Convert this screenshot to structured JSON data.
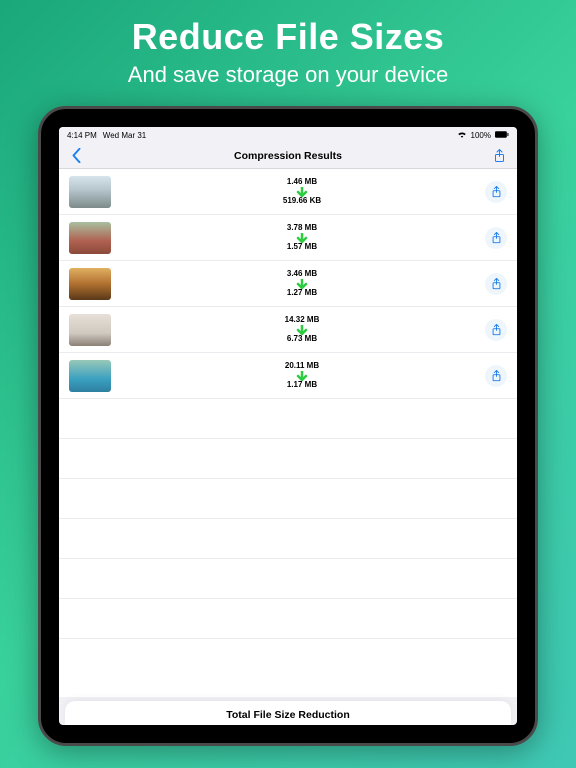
{
  "hero": {
    "title": "Reduce File Sizes",
    "subtitle": "And save storage on your device"
  },
  "status": {
    "time": "4:14 PM",
    "date": "Wed Mar 31",
    "wifi": "wifi-icon",
    "battery_pct": "100%"
  },
  "nav": {
    "title": "Compression Results",
    "back_icon": "chevron-left-icon",
    "share_icon": "share-icon"
  },
  "rows": [
    {
      "original": "1.46 MB",
      "compressed": "519.66 KB"
    },
    {
      "original": "3.78 MB",
      "compressed": "1.57 MB"
    },
    {
      "original": "3.46 MB",
      "compressed": "1.27 MB"
    },
    {
      "original": "14.32 MB",
      "compressed": "6.73 MB"
    },
    {
      "original": "20.11 MB",
      "compressed": "1.17 MB"
    }
  ],
  "footer": {
    "title": "Total File Size Reduction"
  },
  "colors": {
    "accent_blue": "#1e7ff0",
    "arrow_green": "#2ecc40"
  }
}
